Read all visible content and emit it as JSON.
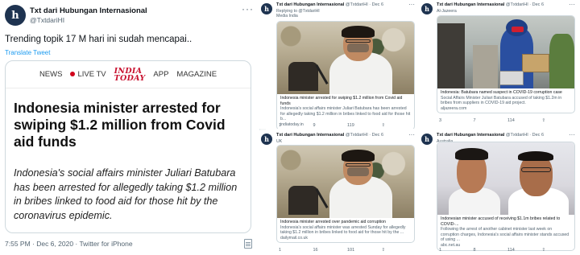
{
  "main_tweet": {
    "display_name": "Txt dari Hubungan Internasional",
    "handle": "@TxtdariHI",
    "avatar_letter": "h",
    "more": "···",
    "text": "Trending topik 17 M hari ini sudah mencapai..",
    "translate": "Translate Tweet",
    "timestamp": "7:55 PM · Dec 6, 2020 · Twitter for iPhone",
    "card": {
      "nav": [
        "NEWS",
        "LIVE TV",
        "APP",
        "MAGAZINE"
      ],
      "logo_top": "INDIA",
      "logo_bottom": "TODAY",
      "headline": "Indonesia minister arrested for swiping $1.2 million from Covid aid funds",
      "summary": "Indonesia's social affairs minister Juliari Batubara has been arrested for allegedly taking $1.2 million in bribes linked to food aid for those hit by the coronavirus epidemic."
    }
  },
  "mini_tweets": [
    {
      "name": "Txt dari Hubungan Internasional",
      "meta": " @TxtdariHI · Dec 6",
      "line1": "Replying to @TxtdariHI",
      "line2": "Media India",
      "title": "Indonesia minister arrested for swiping $1.2 million from Covid aid funds",
      "desc": "Indonesia's social affairs minister Juliari Batubara has been arrested for allegedly taking $1.2 million in bribes linked to food aid for those hit b...",
      "url": "indiatoday.in",
      "actions": [
        "1",
        "9",
        "119",
        ""
      ]
    },
    {
      "name": "Txt dari Hubungan Internasional",
      "meta": " @TxtdariHI · Dec 6",
      "line1": "Al-Jazeera",
      "line2": "",
      "title": "Indonesia: Batubara named suspect in COVID-19 corruption case",
      "desc": "Social Affairs Minister Juliari Batubara accused of taking $1.2m in bribes from suppliers in COVID-19 aid project.",
      "url": "aljazeera.com",
      "actions": [
        "3",
        "7",
        "114",
        ""
      ]
    },
    {
      "name": "Txt dari Hubungan Internasional",
      "meta": " @TxtdariHI · Dec 6",
      "line1": "UK",
      "line2": "",
      "title": "Indonesia minister arrested over pandemic aid corruption",
      "desc": "Indonesia's social affairs minister was arrested Sunday for allegedly taking $1.2 million in bribes linked to food aid for those hit by the ...",
      "url": "dailymail.co.uk",
      "actions": [
        "1",
        "16",
        "101",
        ""
      ]
    },
    {
      "name": "Txt dari Hubungan Internasional",
      "meta": " @TxtdariHI · Dec 6",
      "line1": "Australia",
      "line2": "",
      "title": "Indonesian minister accused of receiving $1.1m bribes related to COVID-...",
      "desc": "Following the arrest of another cabinet minister last week on corruption charges, Indonesia's social affairs minister stands accused of using ...",
      "url": "abc.net.au",
      "actions": [
        "1",
        "8",
        "114",
        ""
      ]
    }
  ],
  "colors": {
    "link": "#1d9bf0",
    "muted": "#536471",
    "brand_red": "#c8102e",
    "avatar_bg": "#1e3350"
  }
}
